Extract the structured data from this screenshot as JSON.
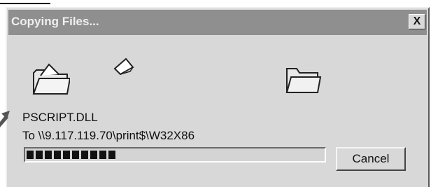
{
  "dialog": {
    "title": "Copying Files...",
    "close_label": "X",
    "file_name": "PSCRIPT.DLL",
    "destination": "To \\\\9.117.119.70\\print$\\W32X86",
    "progress_fraction": 0.3,
    "cancel_label": "Cancel"
  },
  "icons": {
    "source": "folder-open-icon",
    "flying": "document-icon",
    "target": "folder-icon"
  }
}
